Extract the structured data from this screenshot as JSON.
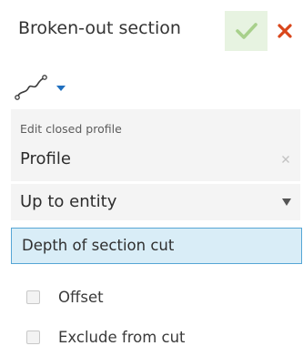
{
  "dialog": {
    "title": "Broken-out section",
    "ok_icon": "check-icon",
    "close_icon": "close-icon",
    "colors": {
      "ok_background": "#e7f3e1",
      "ok_check": "#a8d08b",
      "close": "#d9461b",
      "accent_blue": "#1f6fbf",
      "field_active_bg": "#d9edf7",
      "field_active_border": "#55a6d6"
    }
  },
  "toolbar": {
    "curve_icon": "spline-icon",
    "dropdown_icon": "caret-down-icon"
  },
  "profile": {
    "label": "Edit closed profile",
    "value": "Profile",
    "clear_icon": "close-icon"
  },
  "end_condition": {
    "selected": "Up to entity",
    "caret_icon": "caret-down-icon"
  },
  "depth_field": {
    "placeholder": "Depth of section cut"
  },
  "options": {
    "offset": {
      "label": "Offset",
      "checked": false
    },
    "exclude": {
      "label": "Exclude from cut",
      "checked": false
    }
  }
}
